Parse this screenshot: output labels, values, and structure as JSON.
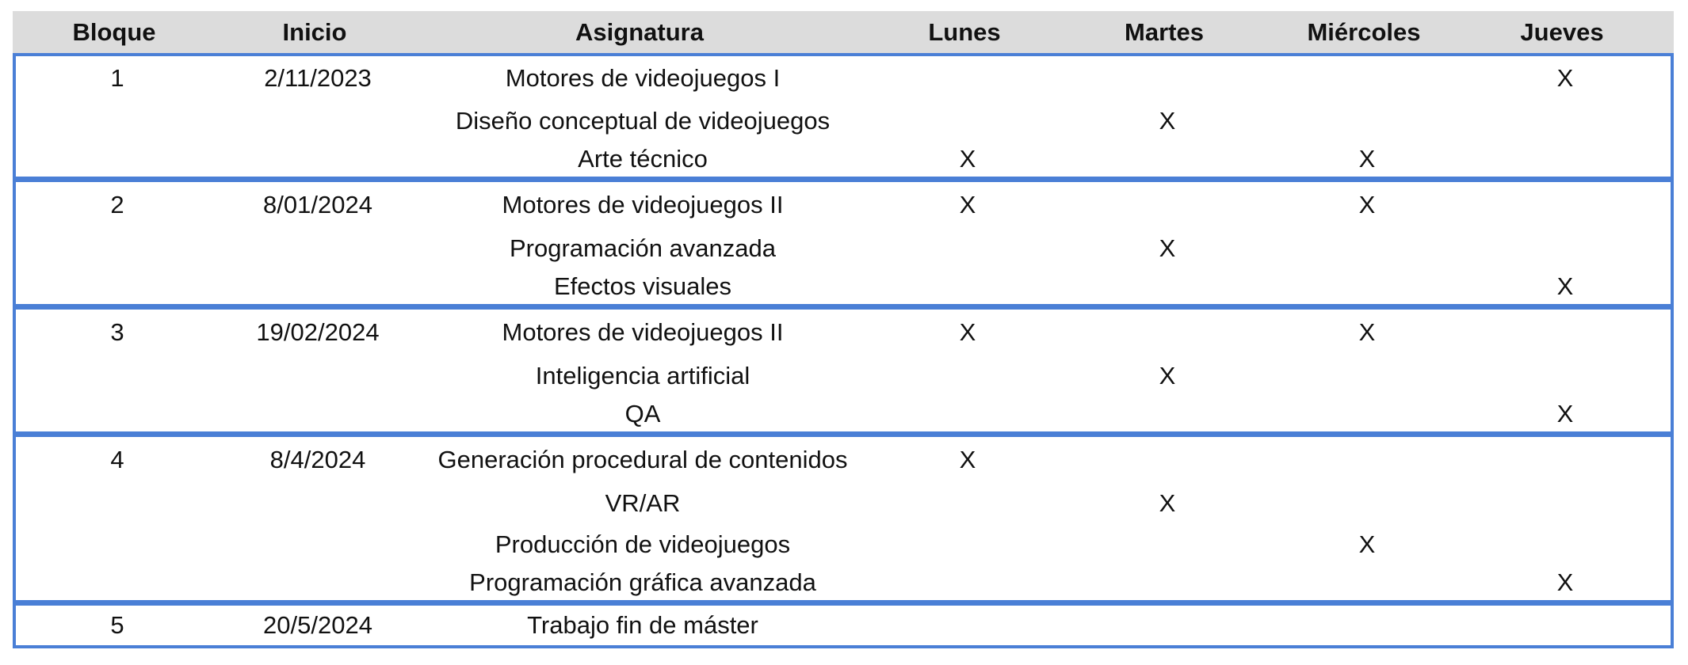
{
  "headers": {
    "bloque": "Bloque",
    "inicio": "Inicio",
    "asignatura": "Asignatura",
    "lunes": "Lunes",
    "martes": "Martes",
    "miercoles": "Miércoles",
    "jueves": "Jueves"
  },
  "mark_symbol": "X",
  "border_color": "#4a7fd6",
  "header_background": "#dcdcdc",
  "blocks": [
    {
      "bloque": "1",
      "inicio": "2/11/2023",
      "rows": [
        {
          "asignatura": "Motores de videojuegos I",
          "days": [
            "",
            "",
            "",
            "X"
          ]
        },
        {
          "asignatura": "Diseño conceptual de videojuegos",
          "days": [
            "",
            "X",
            "",
            ""
          ]
        },
        {
          "asignatura": "Arte técnico",
          "days": [
            "X",
            "",
            "X",
            ""
          ]
        }
      ]
    },
    {
      "bloque": "2",
      "inicio": "8/01/2024",
      "rows": [
        {
          "asignatura": "Motores de videojuegos II",
          "days": [
            "X",
            "",
            "X",
            ""
          ]
        },
        {
          "asignatura": "Programación avanzada",
          "days": [
            "",
            "X",
            "",
            ""
          ]
        },
        {
          "asignatura": "Efectos visuales",
          "days": [
            "",
            "",
            "",
            "X"
          ]
        }
      ]
    },
    {
      "bloque": "3",
      "inicio": "19/02/2024",
      "rows": [
        {
          "asignatura": "Motores de videojuegos II",
          "days": [
            "X",
            "",
            "X",
            ""
          ]
        },
        {
          "asignatura": "Inteligencia artificial",
          "days": [
            "",
            "X",
            "",
            ""
          ]
        },
        {
          "asignatura": "QA",
          "days": [
            "",
            "",
            "",
            "X"
          ]
        }
      ]
    },
    {
      "bloque": "4",
      "inicio": "8/4/2024",
      "rows": [
        {
          "asignatura": "Generación procedural de contenidos",
          "days": [
            "X",
            "",
            "",
            ""
          ]
        },
        {
          "asignatura": "VR/AR",
          "days": [
            "",
            "X",
            "",
            ""
          ]
        },
        {
          "asignatura": "Producción de videojuegos",
          "days": [
            "",
            "",
            "X",
            ""
          ]
        },
        {
          "asignatura": "Programación gráfica avanzada",
          "days": [
            "",
            "",
            "",
            "X"
          ]
        }
      ]
    },
    {
      "bloque": "5",
      "inicio": "20/5/2024",
      "rows": [
        {
          "asignatura": "Trabajo fin de máster",
          "days": [
            "",
            "",
            "",
            ""
          ]
        }
      ]
    }
  ]
}
